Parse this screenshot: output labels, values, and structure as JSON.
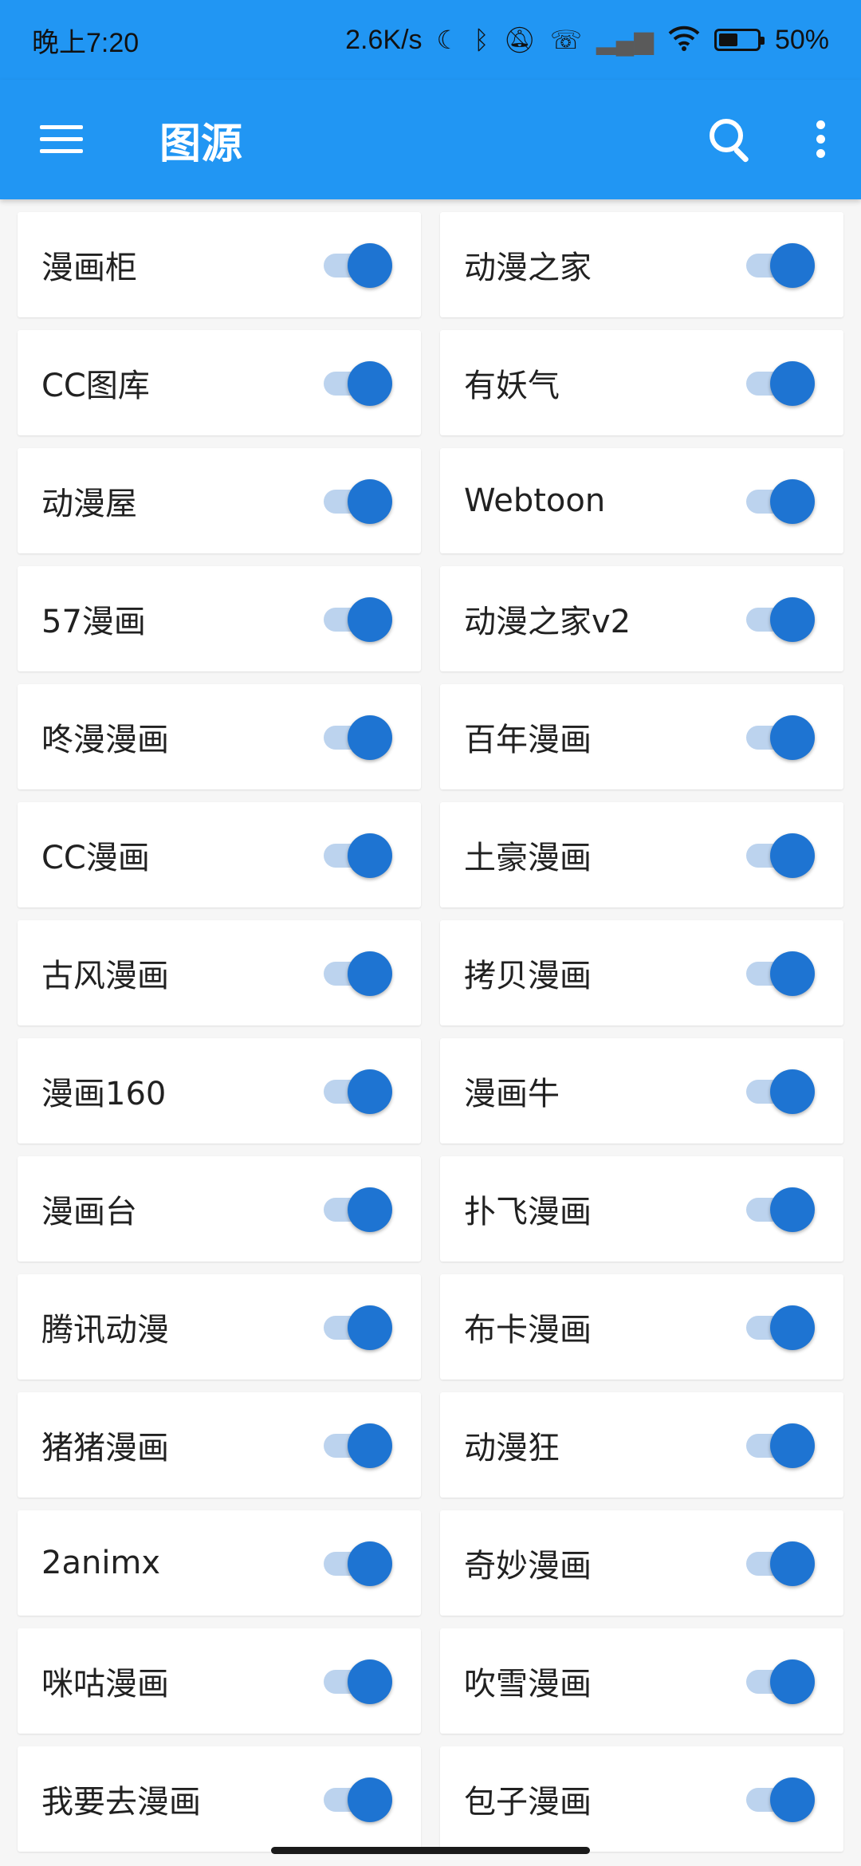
{
  "status_bar": {
    "time": "晚上7:20",
    "network_speed": "2.6K/s",
    "battery_percent": "50%",
    "battery_level": 0.5,
    "icons": [
      "moon-icon",
      "bluetooth-icon",
      "mute-bell-icon",
      "call-icon",
      "signal-icon",
      "wifi-icon",
      "battery-icon"
    ]
  },
  "app_bar": {
    "title": "图源",
    "menu_icon": "hamburger-menu-icon",
    "search_icon": "search-icon",
    "more_icon": "more-vert-icon",
    "color": "#2196f3"
  },
  "sources": [
    {
      "label": "漫画柜",
      "enabled": true
    },
    {
      "label": "动漫之家",
      "enabled": true
    },
    {
      "label": "CC图库",
      "enabled": true
    },
    {
      "label": "有妖气",
      "enabled": true
    },
    {
      "label": "动漫屋",
      "enabled": true
    },
    {
      "label": "Webtoon",
      "enabled": true
    },
    {
      "label": "57漫画",
      "enabled": true
    },
    {
      "label": "动漫之家v2",
      "enabled": true
    },
    {
      "label": "咚漫漫画",
      "enabled": true
    },
    {
      "label": "百年漫画",
      "enabled": true
    },
    {
      "label": "CC漫画",
      "enabled": true
    },
    {
      "label": "土豪漫画",
      "enabled": true
    },
    {
      "label": "古风漫画",
      "enabled": true
    },
    {
      "label": "拷贝漫画",
      "enabled": true
    },
    {
      "label": "漫画160",
      "enabled": true
    },
    {
      "label": "漫画牛",
      "enabled": true
    },
    {
      "label": "漫画台",
      "enabled": true
    },
    {
      "label": "扑飞漫画",
      "enabled": true
    },
    {
      "label": "腾讯动漫",
      "enabled": true
    },
    {
      "label": "布卡漫画",
      "enabled": true
    },
    {
      "label": "猪猪漫画",
      "enabled": true
    },
    {
      "label": "动漫狂",
      "enabled": true
    },
    {
      "label": "2animx",
      "enabled": true
    },
    {
      "label": "奇妙漫画",
      "enabled": true
    },
    {
      "label": "咪咕漫画",
      "enabled": true
    },
    {
      "label": "吹雪漫画",
      "enabled": true
    },
    {
      "label": "我要去漫画",
      "enabled": true
    },
    {
      "label": "包子漫画",
      "enabled": true
    }
  ],
  "colors": {
    "toggle_thumb": "#1e74d2",
    "toggle_track": "#bcd3ee"
  }
}
